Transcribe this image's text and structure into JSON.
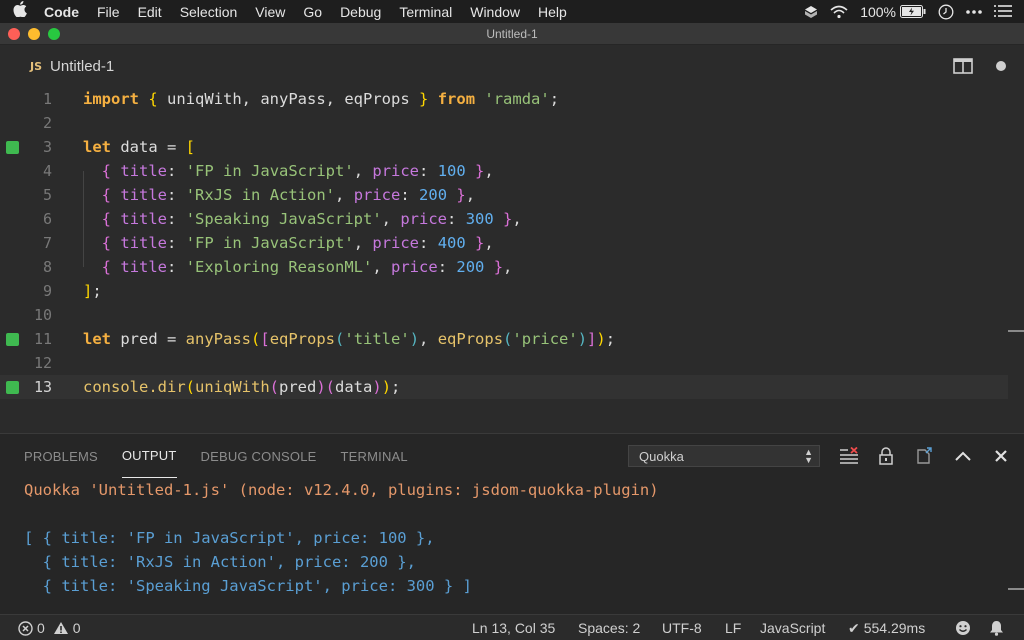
{
  "menubar": {
    "app_name": "Code",
    "items": [
      "File",
      "Edit",
      "Selection",
      "View",
      "Go",
      "Debug",
      "Terminal",
      "Window",
      "Help"
    ],
    "battery": "100%"
  },
  "window": {
    "title": "Untitled-1"
  },
  "tab": {
    "icon_label": "JS",
    "label": "Untitled-1"
  },
  "editor": {
    "lines": [
      {
        "n": "1"
      },
      {
        "n": "2"
      },
      {
        "n": "3"
      },
      {
        "n": "4"
      },
      {
        "n": "5"
      },
      {
        "n": "6"
      },
      {
        "n": "7"
      },
      {
        "n": "8"
      },
      {
        "n": "9"
      },
      {
        "n": "10"
      },
      {
        "n": "11"
      },
      {
        "n": "12"
      },
      {
        "n": "13"
      }
    ],
    "code": {
      "l1_import": "import",
      "l1_names": "uniqWith, anyPass, eqProps",
      "l1_from": "from",
      "l1_module": "'ramda'",
      "l3_let": "let",
      "l3_var": "data",
      "rows": [
        {
          "title": "'FP in JavaScript'",
          "price": "100"
        },
        {
          "title": "'RxJS in Action'",
          "price": "200"
        },
        {
          "title": "'Speaking JavaScript'",
          "price": "300"
        },
        {
          "title": "'FP in JavaScript'",
          "price": "400"
        },
        {
          "title": "'Exploring ReasonML'",
          "price": "200"
        }
      ],
      "prop_title": "title",
      "prop_price": "price",
      "l11_let": "let",
      "l11_var": "pred",
      "l11_anyPass": "anyPass",
      "l11_eqProps": "eqProps",
      "l11_arg1": "'title'",
      "l11_arg2": "'price'",
      "l13_console": "console.dir",
      "l13_uniqWith": "uniqWith",
      "l13_pred": "pred",
      "l13_data": "data"
    }
  },
  "panel": {
    "tabs": [
      "PROBLEMS",
      "OUTPUT",
      "DEBUG CONSOLE",
      "TERMINAL"
    ],
    "active_tab": "OUTPUT",
    "output_channel": "Quokka",
    "output_lines": [
      "Quokka 'Untitled-1.js' (node: v12.4.0, plugins: jsdom-quokka-plugin)",
      "",
      "[ { title: 'FP in JavaScript', price: 100 },",
      "  { title: 'RxJS in Action', price: 200 },",
      "  { title: 'Speaking JavaScript', price: 300 } ]"
    ]
  },
  "statusbar": {
    "errors": "0",
    "warnings": "0",
    "position": "Ln 13, Col 35",
    "spaces": "Spaces: 2",
    "encoding": "UTF-8",
    "eol": "LF",
    "language": "JavaScript",
    "timing": "554.29ms"
  },
  "colors": {
    "gutter_added": "#3fb950",
    "keyword": "#f5b041",
    "string": "#98c379",
    "number": "#61afef",
    "property": "#c678dd",
    "output_header": "#e5986a",
    "output_data": "#5a9fd4"
  }
}
